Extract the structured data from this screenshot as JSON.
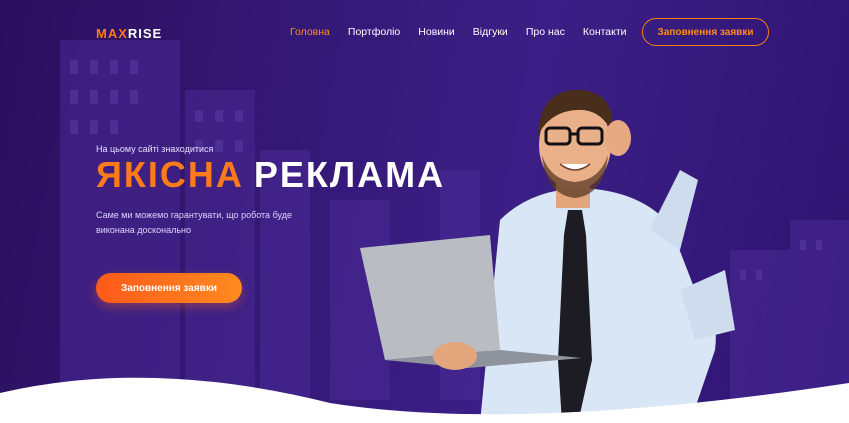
{
  "brand": {
    "logo_accent": "MAX",
    "logo_rest": "RISE"
  },
  "nav": {
    "items": [
      {
        "label": "Головна",
        "active": true
      },
      {
        "label": "Портфоліо",
        "active": false
      },
      {
        "label": "Новини",
        "active": false
      },
      {
        "label": "Відгуки",
        "active": false
      },
      {
        "label": "Про нас",
        "active": false
      },
      {
        "label": "Контакти",
        "active": false
      }
    ],
    "cta_label": "Заповнення заявки"
  },
  "hero": {
    "kicker": "На цьому сайті знаходитися",
    "headline_accent": "ЯКІСНА",
    "headline_rest": "РЕКЛАМА",
    "subtitle": "Саме ми можемо гарантувати, що робота буде виконана досконально",
    "cta_label": "Заповнення заявки",
    "image": "businessman-with-laptop"
  },
  "colors": {
    "accent": "#ff7a1a",
    "background": "#361a7a"
  }
}
